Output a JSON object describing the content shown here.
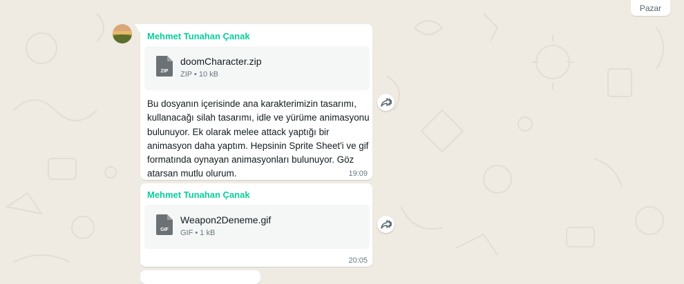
{
  "date_chip": "Pazar",
  "messages": [
    {
      "sender": "Mehmet Tunahan Çanak",
      "file": {
        "name": "doomCharacter.zip",
        "type_badge": "ZIP",
        "meta": "ZIP • 10 kB"
      },
      "text": "Bu dosyanın içerisinde ana karakterimizin tasarımı, kullanacağı silah tasarımı, idle ve yürüme animasyonu bulunuyor. Ek olarak melee attack yaptığı bir animasyon daha yaptım. Hepsinin Sprite Sheet'i ve gif formatında oynayan animasyonları bulunuyor. Göz atarsan mutlu olurum.",
      "time": "19:09"
    },
    {
      "sender": "Mehmet Tunahan Çanak",
      "file": {
        "name": "Weapon2Deneme.gif",
        "type_badge": "GIF",
        "meta": "GIF • 1 kB"
      },
      "time": "20:05"
    }
  ],
  "icons": {
    "forward": "forward-icon",
    "file": "file-icon"
  },
  "colors": {
    "sender": "#06cf9c",
    "background": "#efeae2",
    "bubble": "#ffffff",
    "file_card": "#f5f6f6"
  }
}
